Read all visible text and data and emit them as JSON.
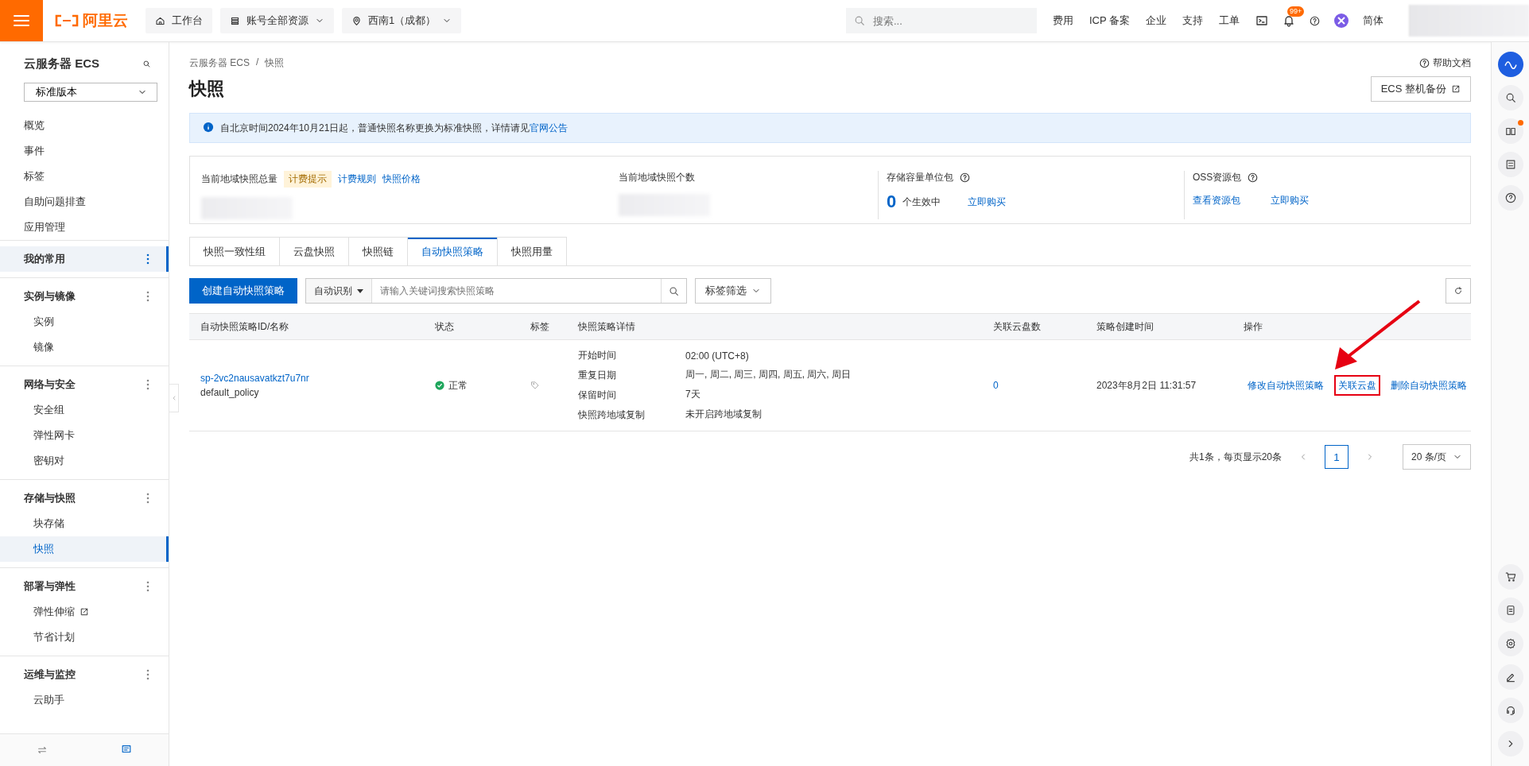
{
  "topbar": {
    "logo_text": "阿里云",
    "nav": [
      {
        "label": "工作台",
        "kind": "home"
      },
      {
        "label": "账号全部资源",
        "kind": "dropdown"
      },
      {
        "label": "西南1（成都）",
        "kind": "region"
      }
    ],
    "search": {
      "placeholder": "搜索..."
    },
    "links": [
      "费用",
      "ICP 备案",
      "企业",
      "支持",
      "工单"
    ],
    "notification_badge": "99+",
    "language": "简体"
  },
  "sidebar": {
    "title": "云服务器 ECS",
    "edition": "标准版本",
    "items": [
      {
        "label": "概览",
        "selected": false
      },
      {
        "label": "事件",
        "selected": false
      },
      {
        "label": "标签",
        "selected": false
      },
      {
        "label": "自助问题排查",
        "selected": false
      },
      {
        "label": "应用管理",
        "selected": false
      }
    ],
    "groups": [
      {
        "title": "我的常用",
        "selected": true
      },
      {
        "title": "实例与镜像",
        "selected": false,
        "children": [
          {
            "label": "实例",
            "selected": false,
            "external": false
          },
          {
            "label": "镜像",
            "selected": false,
            "external": false
          }
        ]
      },
      {
        "title": "网络与安全",
        "selected": false,
        "children": [
          {
            "label": "安全组",
            "selected": false,
            "external": false
          },
          {
            "label": "弹性网卡",
            "selected": false,
            "external": false
          },
          {
            "label": "密钥对",
            "selected": false,
            "external": false
          }
        ]
      },
      {
        "title": "存储与快照",
        "selected": false,
        "children": [
          {
            "label": "块存储",
            "selected": false,
            "external": false
          },
          {
            "label": "快照",
            "selected": true,
            "external": false
          }
        ]
      },
      {
        "title": "部署与弹性",
        "selected": false,
        "children": [
          {
            "label": "弹性伸缩",
            "selected": false,
            "external": true
          },
          {
            "label": "节省计划",
            "selected": false,
            "external": false
          }
        ]
      },
      {
        "title": "运维与监控",
        "selected": false,
        "children": [
          {
            "label": "云助手",
            "selected": false,
            "external": false
          }
        ]
      }
    ]
  },
  "breadcrumb": {
    "items": [
      "云服务器 ECS",
      "快照"
    ],
    "separator": "/"
  },
  "help_link": "帮助文档",
  "title": "快照",
  "backup_button": "ECS 整机备份",
  "notice": {
    "text": "自北京时间2024年10月21日起，普通快照名称更换为标准快照，详情请见",
    "link": "官网公告"
  },
  "stats": [
    {
      "kind": "redacted",
      "label": "当前地域快照总量",
      "help": false,
      "tag": "计费提示",
      "links": [
        "计费规则",
        "快照价格"
      ]
    },
    {
      "kind": "redacted",
      "label": "当前地域快照个数",
      "help": false
    },
    {
      "kind": "count",
      "label": "存储容量单位包",
      "help": true,
      "value": "0",
      "unit": "个生效中",
      "links": [
        "立即购买"
      ]
    },
    {
      "kind": "links",
      "label": "OSS资源包",
      "help": true,
      "links": [
        "查看资源包",
        "立即购买"
      ]
    }
  ],
  "tabs": [
    {
      "label": "快照一致性组",
      "selected": false
    },
    {
      "label": "云盘快照",
      "selected": false
    },
    {
      "label": "快照链",
      "selected": false
    },
    {
      "label": "自动快照策略",
      "selected": true
    },
    {
      "label": "快照用量",
      "selected": false
    }
  ],
  "toolbar": {
    "create_button": "创建自动快照策略",
    "search_mode": "自动识别",
    "search_placeholder": "请输入关键词搜索快照策略",
    "tag_filter": "标签筛选"
  },
  "table": {
    "columns": [
      "自动快照策略ID/名称",
      "状态",
      "标签",
      "快照策略详情",
      "关联云盘数",
      "策略创建时间",
      "操作"
    ],
    "rows": [
      {
        "id": "sp-2vc2nausavatkzt7u7nr",
        "name": "default_policy",
        "status": "正常",
        "details": [
          {
            "label": "开始时间",
            "value": "02:00 (UTC+8)"
          },
          {
            "label": "重复日期",
            "value": "周一, 周二, 周三, 周四, 周五, 周六, 周日"
          },
          {
            "label": "保留时间",
            "value": "7天"
          },
          {
            "label": "快照跨地域复制",
            "value": "未开启跨地域复制"
          }
        ],
        "disks": "0",
        "created": "2023年8月2日 11:31:57",
        "actions": [
          {
            "label": "修改自动快照策略",
            "highlighted": false
          },
          {
            "label": "关联云盘",
            "highlighted": true
          },
          {
            "label": "删除自动快照策略",
            "highlighted": false
          }
        ]
      }
    ]
  },
  "pagination": {
    "summary": "共1条，每页显示20条",
    "pages": [
      {
        "label": "1",
        "selected": true
      }
    ],
    "page_size": "20 条/页"
  }
}
